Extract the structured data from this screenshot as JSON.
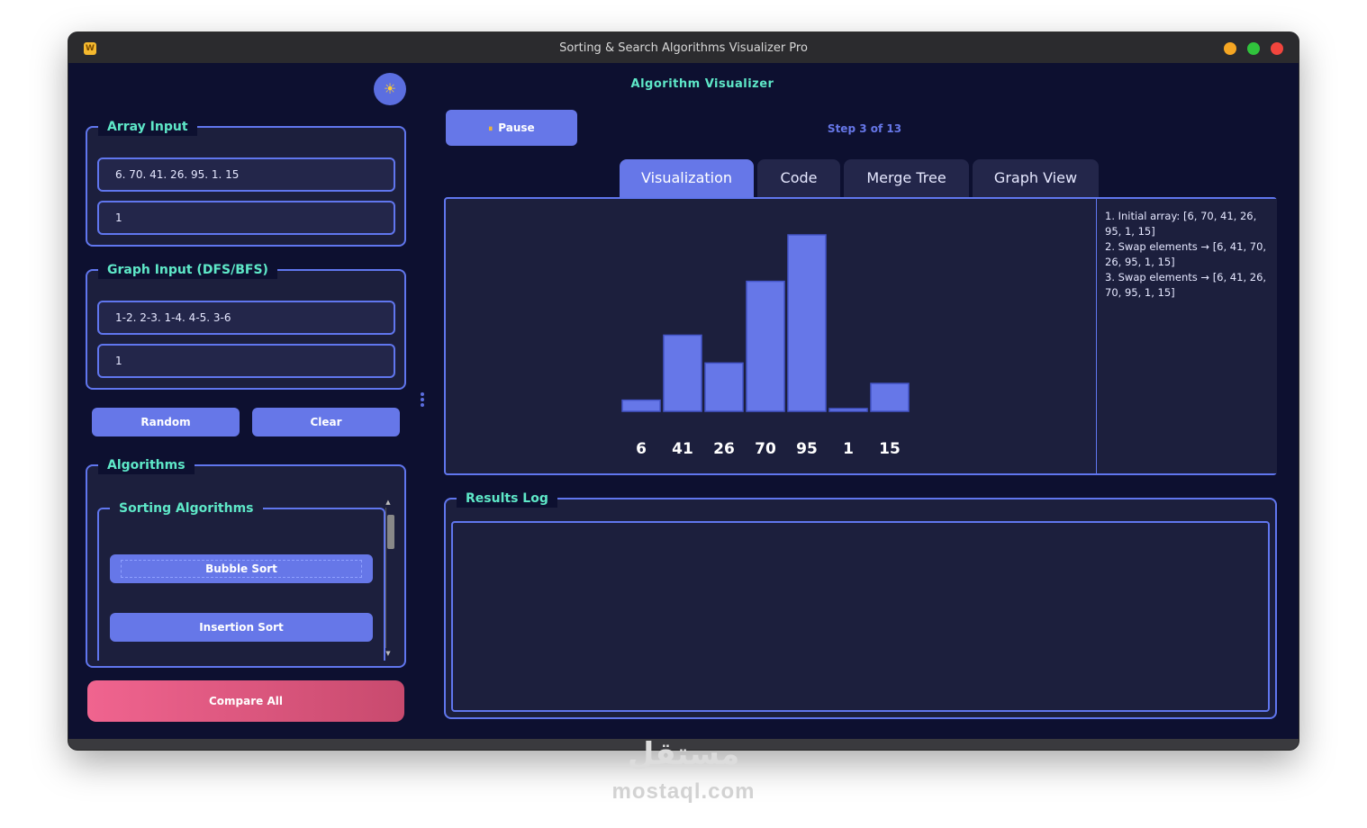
{
  "window": {
    "title": "Sorting & Search Algorithms Visualizer Pro",
    "app_icon_letter": "W"
  },
  "sidebar": {
    "theme_toggle_glyph": "☀",
    "array_input": {
      "legend": "Array Input",
      "array_value": "6. 70. 41. 26. 95. 1. 15",
      "target_value": "1"
    },
    "graph_input": {
      "legend": "Graph Input (DFS/BFS)",
      "edges_value": "1-2. 2-3. 1-4. 4-5. 3-6",
      "start_value": "1"
    },
    "random_label": "Random",
    "clear_label": "Clear",
    "algorithms": {
      "legend": "Algorithms",
      "sorting_legend": "Sorting Algorithms",
      "items": [
        "Bubble Sort",
        "Insertion Sort"
      ]
    },
    "compare_all_label": "Compare All"
  },
  "main": {
    "heading": "Algorithm Visualizer",
    "pause_label": "Pause",
    "pause_icon": "⏸",
    "step_text": "Step 3 of 13",
    "tabs": [
      {
        "label": "Visualization",
        "active": true
      },
      {
        "label": "Code",
        "active": false
      },
      {
        "label": "Merge Tree",
        "active": false
      },
      {
        "label": "Graph View",
        "active": false
      }
    ],
    "steps_log": [
      "1. Initial array: [6, 70, 41, 26, 95, 1, 15]",
      "2. Swap elements → [6, 41, 70, 26, 95, 1, 15]",
      "3. Swap elements → [6, 41, 26, 70, 95, 1, 15]"
    ],
    "results_legend": "Results Log"
  },
  "chart_data": {
    "type": "bar",
    "categories": [
      "6",
      "41",
      "26",
      "70",
      "95",
      "1",
      "15"
    ],
    "values": [
      6,
      41,
      26,
      70,
      95,
      1,
      15
    ],
    "title": "",
    "xlabel": "",
    "ylabel": "",
    "ylim": [
      0,
      95
    ],
    "grid": false,
    "bar_color": "#6677e8",
    "label_color": "#ffffff"
  },
  "colors": {
    "accent": "#6677e8",
    "heading": "#5ee8c8",
    "background": "#0d1030",
    "panel": "#1c1f3d",
    "compare_gradient_start": "#f0648f",
    "compare_gradient_end": "#c84a6e"
  },
  "watermark": {
    "logo_text": "مستقل",
    "site": "mostaql.com"
  }
}
